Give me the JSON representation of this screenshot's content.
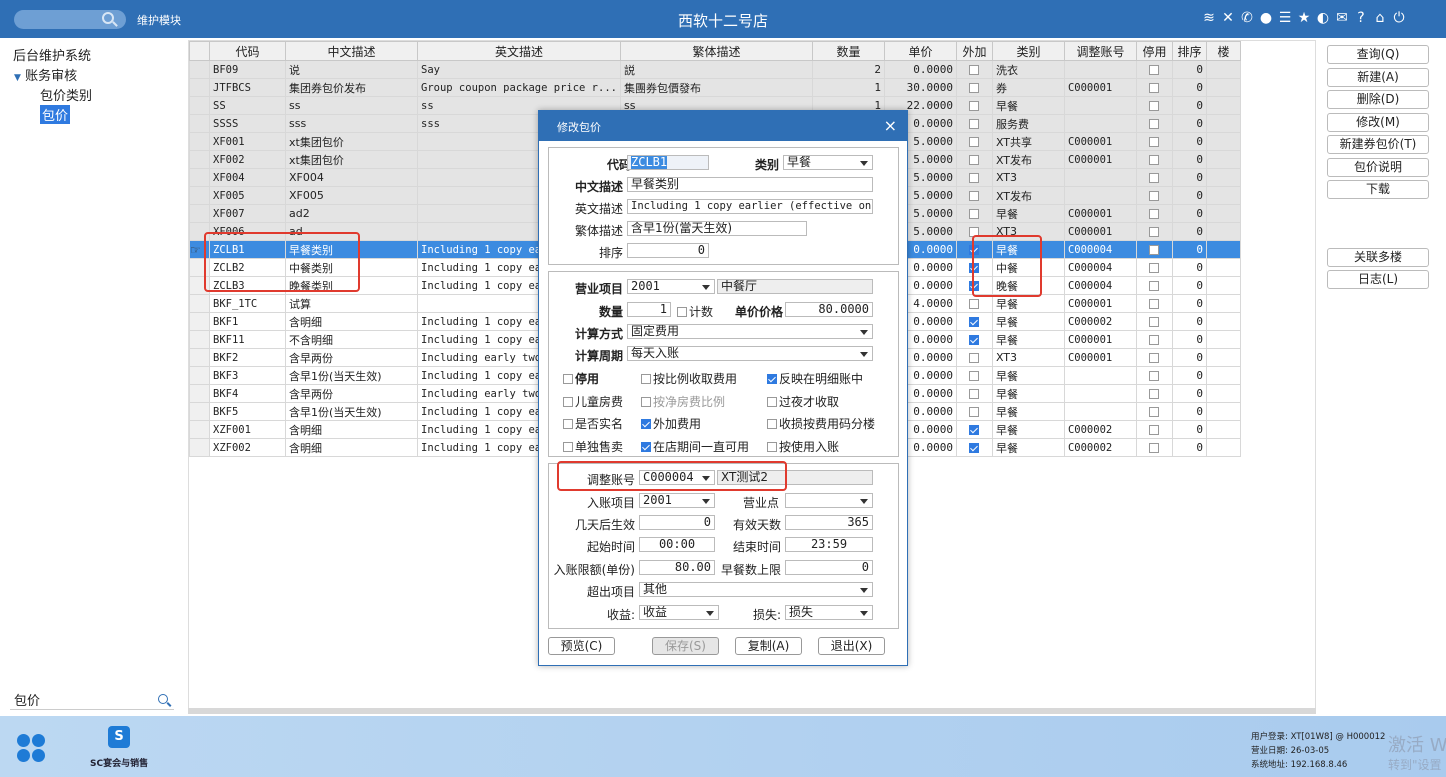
{
  "topbar": {
    "search_placeholder": "",
    "module_label": "维护模块",
    "store_title": "西软十二号店",
    "icons": [
      "wifi-icon",
      "tools-icon",
      "phone-icon",
      "palette-icon",
      "menu-icon",
      "star-icon",
      "theme-icon",
      "mail-icon",
      "help-icon",
      "home-icon",
      "power-icon"
    ]
  },
  "nav": {
    "root": "后台维护系统",
    "group": "账务审核",
    "items": [
      "包价类别",
      "包价"
    ],
    "search_value": "包价"
  },
  "grid": {
    "columns": [
      "代码",
      "中文描述",
      "英文描述",
      "繁体描述",
      "数量",
      "单价",
      "外加",
      "类别",
      "调整账号",
      "停用",
      "排序",
      "楼"
    ],
    "rows": [
      {
        "code": "BF09",
        "cn": "说",
        "en": "Say",
        "tw": "説",
        "qty": "2",
        "price": "0.0000",
        "extra": false,
        "cat": "洗衣",
        "acct": "",
        "stop": false,
        "sort": "0",
        "gray": true
      },
      {
        "code": "JTFBCS",
        "cn": "集团券包价发布",
        "en": "Group coupon package price r...",
        "tw": "集團券包價發布",
        "qty": "1",
        "price": "30.0000",
        "extra": false,
        "cat": "券",
        "acct": "C000001",
        "stop": false,
        "sort": "0",
        "gray": true
      },
      {
        "code": "SS",
        "cn": "ss",
        "en": "ss",
        "tw": "ss",
        "qty": "1",
        "price": "22.0000",
        "extra": false,
        "cat": "早餐",
        "acct": "",
        "stop": false,
        "sort": "0",
        "gray": true
      },
      {
        "code": "SSSS",
        "cn": "sss",
        "en": "sss",
        "tw": "",
        "qty": "",
        "price": "0.0000",
        "extra": false,
        "cat": "服务费",
        "acct": "",
        "stop": false,
        "sort": "0",
        "gray": true
      },
      {
        "code": "XF001",
        "cn": "xt集团包价",
        "en": "",
        "tw": "",
        "qty": "",
        "price": "5.0000",
        "extra": false,
        "cat": "XT共享",
        "acct": "C000001",
        "stop": false,
        "sort": "0",
        "gray": true
      },
      {
        "code": "XF002",
        "cn": "xt集团包价",
        "en": "",
        "tw": "",
        "qty": "",
        "price": "5.0000",
        "extra": false,
        "cat": "XT发布",
        "acct": "C000001",
        "stop": false,
        "sort": "0",
        "gray": true
      },
      {
        "code": "XF004",
        "cn": "XF004",
        "en": "",
        "tw": "",
        "qty": "",
        "price": "5.0000",
        "extra": false,
        "cat": "XT3",
        "acct": "",
        "stop": false,
        "sort": "0",
        "gray": true
      },
      {
        "code": "XF005",
        "cn": "XF005",
        "en": "",
        "tw": "",
        "qty": "",
        "price": "5.0000",
        "extra": false,
        "cat": "XT发布",
        "acct": "",
        "stop": false,
        "sort": "0",
        "gray": true
      },
      {
        "code": "XF007",
        "cn": "ad2",
        "en": "",
        "tw": "",
        "qty": "",
        "price": "5.0000",
        "extra": false,
        "cat": "早餐",
        "acct": "C000001",
        "stop": false,
        "sort": "0",
        "gray": true
      },
      {
        "code": "XF006",
        "cn": "ad",
        "en": "",
        "tw": "",
        "qty": "",
        "price": "5.0000",
        "extra": false,
        "cat": "XT3",
        "acct": "C000001",
        "stop": false,
        "sort": "0",
        "gray": true
      },
      {
        "code": "ZCLB1",
        "cn": "早餐类别",
        "en": "Including 1 copy ear",
        "tw": "",
        "qty": "",
        "price": "0.0000",
        "extra": true,
        "cat": "早餐",
        "acct": "C000004",
        "stop": false,
        "sort": "0",
        "sel": true
      },
      {
        "code": "ZCLB2",
        "cn": "中餐类别",
        "en": "Including 1 copy ear",
        "tw": "",
        "qty": "",
        "price": "0.0000",
        "extra": true,
        "cat": "中餐",
        "acct": "C000004",
        "stop": false,
        "sort": "0"
      },
      {
        "code": "ZCLB3",
        "cn": "晚餐类别",
        "en": "Including 1 copy ear",
        "tw": "",
        "qty": "",
        "price": "0.0000",
        "extra": true,
        "cat": "晚餐",
        "acct": "C000004",
        "stop": false,
        "sort": "0"
      },
      {
        "code": "BKF_1TC",
        "cn": "试算",
        "en": "",
        "tw": "",
        "qty": "",
        "price": "4.0000",
        "extra": false,
        "cat": "早餐",
        "acct": "C000001",
        "stop": false,
        "sort": "0"
      },
      {
        "code": "BKF1",
        "cn": "含明细",
        "en": "Including 1 copy ear",
        "tw": "",
        "qty": "",
        "price": "0.0000",
        "extra": true,
        "cat": "早餐",
        "acct": "C000002",
        "stop": false,
        "sort": "0"
      },
      {
        "code": "BKF11",
        "cn": "不含明细",
        "en": "Including 1 copy ear",
        "tw": "",
        "qty": "",
        "price": "0.0000",
        "extra": true,
        "cat": "早餐",
        "acct": "C000001",
        "stop": false,
        "sort": "0"
      },
      {
        "code": "BKF2",
        "cn": "含早两份",
        "en": "Including early two",
        "tw": "",
        "qty": "",
        "price": "0.0000",
        "extra": false,
        "cat": "XT3",
        "acct": "C000001",
        "stop": false,
        "sort": "0"
      },
      {
        "code": "BKF3",
        "cn": "含早1份(当天生效)",
        "en": "Including 1 copy ear",
        "tw": "",
        "qty": "",
        "price": "0.0000",
        "extra": false,
        "cat": "早餐",
        "acct": "",
        "stop": false,
        "sort": "0"
      },
      {
        "code": "BKF4",
        "cn": "含早两份",
        "en": "Including early two",
        "tw": "",
        "qty": "",
        "price": "0.0000",
        "extra": false,
        "cat": "早餐",
        "acct": "",
        "stop": false,
        "sort": "0"
      },
      {
        "code": "BKF5",
        "cn": "含早1份(当天生效)",
        "en": "Including 1 copy ear",
        "tw": "",
        "qty": "",
        "price": "0.0000",
        "extra": false,
        "cat": "早餐",
        "acct": "",
        "stop": false,
        "sort": "0"
      },
      {
        "code": "XZF001",
        "cn": "含明细",
        "en": "Including 1 copy ear",
        "tw": "",
        "qty": "",
        "price": "0.0000",
        "extra": true,
        "cat": "早餐",
        "acct": "C000002",
        "stop": false,
        "sort": "0"
      },
      {
        "code": "XZF002",
        "cn": "含明细",
        "en": "Including 1 copy ear",
        "tw": "",
        "qty": "",
        "price": "0.0000",
        "extra": true,
        "cat": "早餐",
        "acct": "C000002",
        "stop": false,
        "sort": "0"
      }
    ]
  },
  "actions": {
    "query": "查询(Q)",
    "new": "新建(A)",
    "delete": "删除(D)",
    "edit": "修改(M)",
    "new_coupon": "新建券包价(T)",
    "package_desc": "包价说明",
    "download": "下载",
    "link_floors": "关联多楼",
    "log": "日志(L)"
  },
  "dialog": {
    "title": "修改包价",
    "close": "×",
    "code_label": "代码",
    "code_value": "ZCLB1",
    "category_label": "类别",
    "category_value": "早餐",
    "cn_label": "中文描述",
    "cn_value": "早餐类别",
    "en_label": "英文描述",
    "en_value": "Including 1 copy earlier (effective on tl",
    "tw_label": "繁体描述",
    "tw_value": "含早1份(當天生效)",
    "sort_label": "排序",
    "sort_value": "0",
    "outlet_label": "营业项目",
    "outlet_code": "2001",
    "outlet_name": "中餐厅",
    "qty_label": "数量",
    "qty_value": "1",
    "count_label": "计数",
    "unit_price_label": "单价价格",
    "unit_price_value": "80.0000",
    "calc_method_label": "计算方式",
    "calc_method_value": "固定费用",
    "calc_period_label": "计算周期",
    "calc_period_value": "每天入账",
    "checks": [
      {
        "label": "停用",
        "checked": false,
        "bold": true,
        "disabled": false
      },
      {
        "label": "按比例收取费用",
        "checked": false,
        "bold": false,
        "disabled": false
      },
      {
        "label": "反映在明细账中",
        "checked": true,
        "bold": false,
        "disabled": false
      },
      {
        "label": "儿童房费",
        "checked": false,
        "bold": false,
        "disabled": false
      },
      {
        "label": "按净房费比例",
        "checked": false,
        "bold": false,
        "disabled": true
      },
      {
        "label": "过夜才收取",
        "checked": false,
        "bold": false,
        "disabled": false
      },
      {
        "label": "是否实名",
        "checked": false,
        "bold": false,
        "disabled": false
      },
      {
        "label": "外加费用",
        "checked": true,
        "bold": false,
        "disabled": false
      },
      {
        "label": "收损按费用码分楼",
        "checked": false,
        "bold": false,
        "disabled": false
      },
      {
        "label": "单独售卖",
        "checked": false,
        "bold": false,
        "disabled": false
      },
      {
        "label": "在店期间一直可用",
        "checked": true,
        "bold": false,
        "disabled": false
      },
      {
        "label": "按使用入账",
        "checked": false,
        "bold": false,
        "disabled": false
      }
    ],
    "adj_acct_label": "调整账号",
    "adj_acct_code": "C000004",
    "adj_acct_name": "XT测试2",
    "post_item_label": "入账项目",
    "post_item_value": "2001",
    "outlet_point_label": "营业点",
    "outlet_point_value": "",
    "days_after_label": "几天后生效",
    "days_after_value": "0",
    "valid_days_label": "有效天数",
    "valid_days_value": "365",
    "start_time_label": "起始时间",
    "start_time_value": "00:00",
    "end_time_label": "结束时间",
    "end_time_value": "23:59",
    "post_limit_label": "入账限额(单份)",
    "post_limit_value": "80.00",
    "bf_limit_label": "早餐数上限",
    "bf_limit_value": "0",
    "overflow_label": "超出项目",
    "overflow_value": "其他",
    "income_label": "收益:",
    "income_value": "收益",
    "loss_label": "损失:",
    "loss_value": "损失",
    "btn_preview": "预览(C)",
    "btn_save": "保存(S)",
    "btn_copy": "复制(A)",
    "btn_exit": "退出(X)"
  },
  "taskbar": {
    "app_letter": "S",
    "app_label": "SC宴会与销售",
    "user_line": "用户登录: XT[01W8] @ H000012",
    "date_line": "营业日期: 26-03-05",
    "ip_line": "系统地址: 192.168.8.46",
    "watermark1": "激活 W",
    "watermark2": "转到\"设置"
  },
  "colors": {
    "primary": "#2f6fb5",
    "selected_row": "#3c8be0",
    "annotation": "#e03a2e"
  }
}
